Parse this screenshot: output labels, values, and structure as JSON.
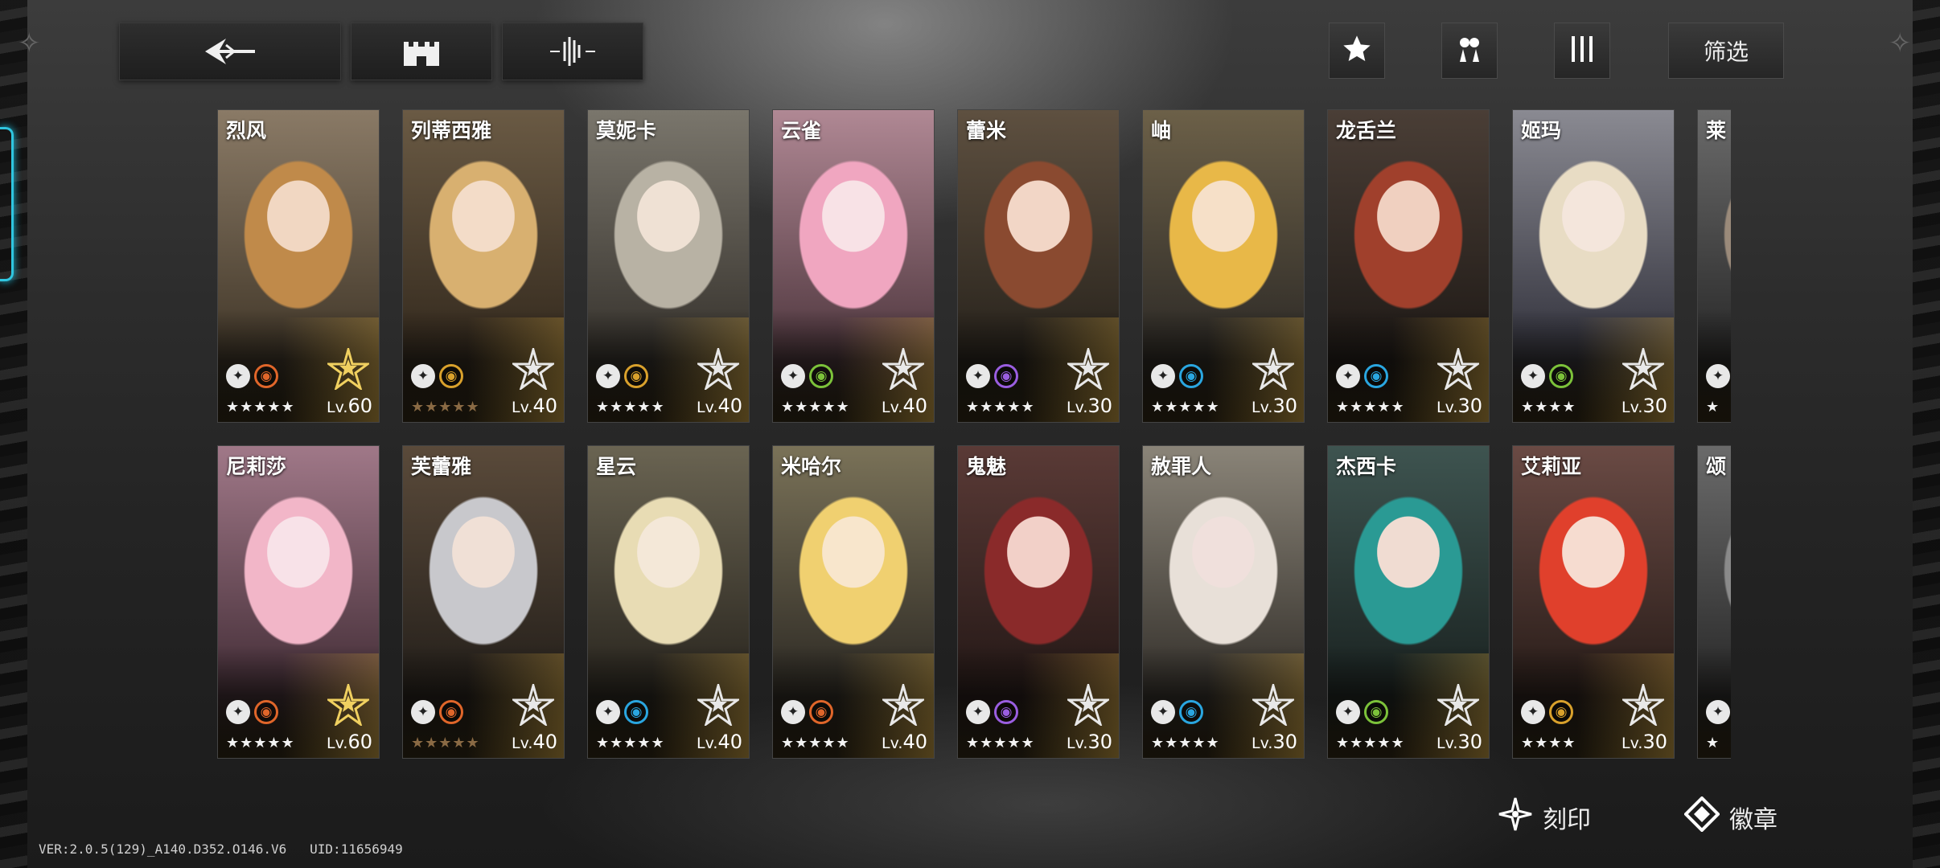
{
  "toolbar": {
    "back_icon": "back-arrow-icon",
    "base_icon": "castle-icon",
    "tune_icon": "waveform-icon",
    "favorite_icon": "star-icon",
    "team_icon": "team-icon",
    "columns_icon": "columns-icon",
    "filter_label": "筛选"
  },
  "roster": {
    "row1": [
      {
        "name": "烈风",
        "stars": "★★★★★",
        "lv_prefix": "Lv.",
        "level": "60",
        "class_icon": "shield-wing-icon",
        "element_icon": "fire-icon",
        "element_color": "#e0662a",
        "rank_icon": "gold-star-emblem-icon"
      },
      {
        "name": "列蒂西雅",
        "stars": "★★★★★",
        "lv_prefix": "Lv.",
        "level": "40",
        "class_icon": "spear-icon",
        "element_icon": "sun-icon",
        "element_color": "#d9a12c",
        "rank_icon": "star-emblem-icon"
      },
      {
        "name": "莫妮卡",
        "stars": "★★★★★",
        "lv_prefix": "Lv.",
        "level": "40",
        "class_icon": "spear-icon",
        "element_icon": "sun-icon",
        "element_color": "#d9a12c",
        "rank_icon": "star-emblem-icon"
      },
      {
        "name": "云雀",
        "stars": "★★★★★",
        "lv_prefix": "Lv.",
        "level": "40",
        "class_icon": "wings-icon",
        "element_icon": "leaf-icon",
        "element_color": "#7cc23a",
        "rank_icon": "star-emblem-icon"
      },
      {
        "name": "蕾米",
        "stars": "★★★★★",
        "lv_prefix": "Lv.",
        "level": "30",
        "class_icon": "shield-wing-icon",
        "element_icon": "void-icon",
        "element_color": "#9a5ee0",
        "rank_icon": "star-emblem-icon"
      },
      {
        "name": "岫",
        "stars": "★★★★★",
        "lv_prefix": "Lv.",
        "level": "30",
        "class_icon": "wings-icon",
        "element_icon": "water-icon",
        "element_color": "#2aa6e0",
        "rank_icon": "star-emblem-icon"
      },
      {
        "name": "龙舌兰",
        "stars": "★★★★★",
        "lv_prefix": "Lv.",
        "level": "30",
        "class_icon": "shield-wing-icon",
        "element_icon": "water-icon",
        "element_color": "#2aa6e0",
        "rank_icon": "star-emblem-icon"
      },
      {
        "name": "姬玛",
        "stars": "★★★★",
        "lv_prefix": "Lv.",
        "level": "30",
        "class_icon": "spear-icon",
        "element_icon": "leaf-icon",
        "element_color": "#7cc23a",
        "rank_icon": "star-emblem-icon"
      },
      {
        "name": "莱",
        "stars": "★",
        "lv_prefix": "",
        "level": "",
        "class_icon": "spear-icon",
        "element_icon": "",
        "element_color": "#888888",
        "rank_icon": ""
      }
    ],
    "row2": [
      {
        "name": "尼莉莎",
        "stars": "★★★★★",
        "lv_prefix": "Lv.",
        "level": "60",
        "class_icon": "wings-icon",
        "element_icon": "fire-icon",
        "element_color": "#e0662a",
        "rank_icon": "gold-star-emblem-icon"
      },
      {
        "name": "芙蕾雅",
        "stars": "★★★★★",
        "lv_prefix": "Lv.",
        "level": "40",
        "class_icon": "wings-icon",
        "element_icon": "fire-icon",
        "element_color": "#e0662a",
        "rank_icon": "star-emblem-icon"
      },
      {
        "name": "星云",
        "stars": "★★★★★",
        "lv_prefix": "Lv.",
        "level": "40",
        "class_icon": "crown-icon",
        "element_icon": "water-icon",
        "element_color": "#2aa6e0",
        "rank_icon": "star-emblem-icon"
      },
      {
        "name": "米哈尔",
        "stars": "★★★★★",
        "lv_prefix": "Lv.",
        "level": "40",
        "class_icon": "spear-icon",
        "element_icon": "fire-icon",
        "element_color": "#e0662a",
        "rank_icon": "star-emblem-icon"
      },
      {
        "name": "鬼魅",
        "stars": "★★★★★",
        "lv_prefix": "Lv.",
        "level": "30",
        "class_icon": "crown-icon",
        "element_icon": "void-icon",
        "element_color": "#9a5ee0",
        "rank_icon": "star-emblem-icon"
      },
      {
        "name": "赦罪人",
        "stars": "★★★★★",
        "lv_prefix": "Lv.",
        "level": "30",
        "class_icon": "spear-icon",
        "element_icon": "water-icon",
        "element_color": "#2aa6e0",
        "rank_icon": "star-emblem-icon"
      },
      {
        "name": "杰西卡",
        "stars": "★★★★★",
        "lv_prefix": "Lv.",
        "level": "30",
        "class_icon": "shield-wing-icon",
        "element_icon": "leaf-icon",
        "element_color": "#7cc23a",
        "rank_icon": "star-emblem-icon"
      },
      {
        "name": "艾莉亚",
        "stars": "★★★★",
        "lv_prefix": "Lv.",
        "level": "30",
        "class_icon": "shield-wing-icon",
        "element_icon": "sun-icon",
        "element_color": "#d9a12c",
        "rank_icon": "star-emblem-icon"
      },
      {
        "name": "颂",
        "stars": "★",
        "lv_prefix": "",
        "level": "",
        "class_icon": "spear-icon",
        "element_icon": "",
        "element_color": "#888888",
        "rank_icon": ""
      }
    ]
  },
  "actions": {
    "imprint_label": "刻印",
    "imprint_icon": "imprint-icon",
    "badge_label": "徽章",
    "badge_icon": "badge-icon"
  },
  "footer": {
    "version": "VER:2.0.5(129)_A140.D352.O146.V6",
    "uid": "UID:11656949"
  }
}
